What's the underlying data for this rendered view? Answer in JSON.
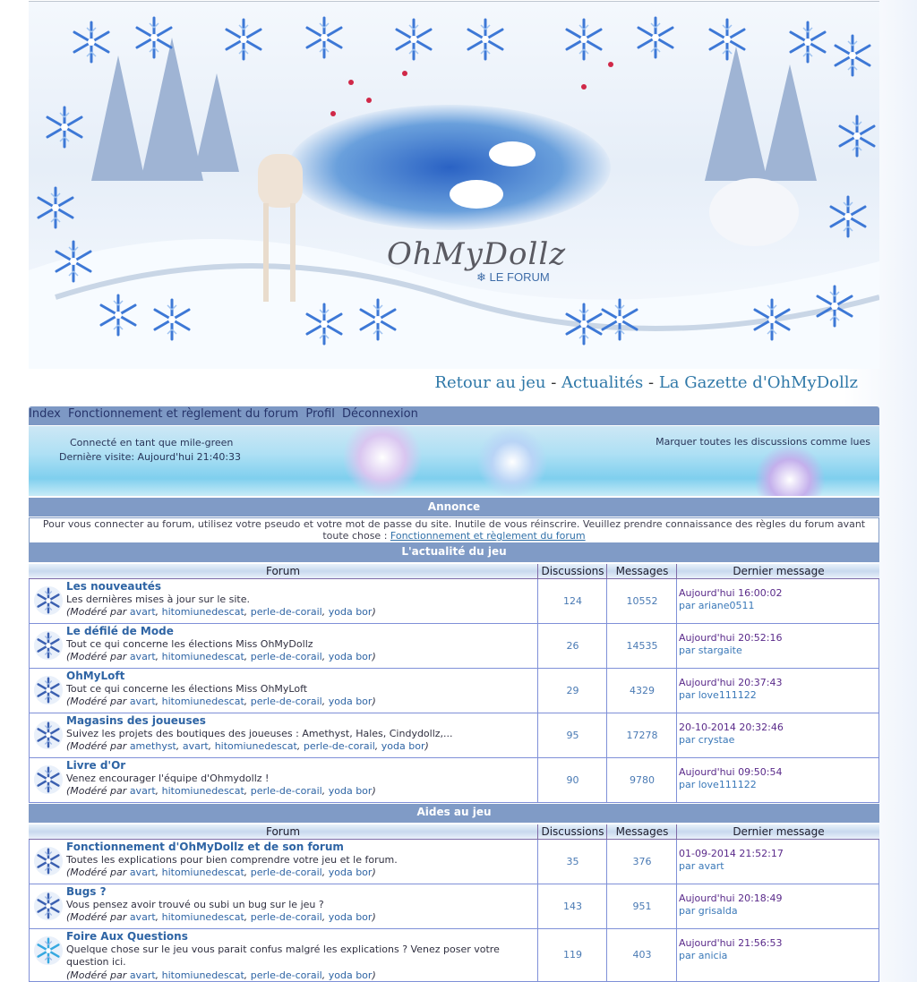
{
  "header": {
    "logo_text": "OhMyDollz",
    "logo_subtext": "LE FORUM",
    "links": [
      "Retour au jeu",
      "Actualités",
      "La Gazette d'OhMyDollz"
    ],
    "separator": " - "
  },
  "nav": {
    "items": [
      "Index",
      "Fonctionnement et règlement du forum",
      "Profil",
      "Déconnexion"
    ]
  },
  "info": {
    "connected": "Connecté en tant que mile-green",
    "last_visit": "Dernière visite: Aujourd'hui 21:40:33",
    "mark_read": "Marquer toutes les discussions comme lues"
  },
  "announcement": {
    "title": "Annonce",
    "text": "Pour vous connecter au forum, utilisez votre pseudo et votre mot de passe du site. Inutile de vous réinscrire. Veuillez prendre connaissance des règles du forum avant toute chose :",
    "link": "Fonctionnement et règlement du forum"
  },
  "columns": {
    "forum": "Forum",
    "discussions": "Discussions",
    "messages": "Messages",
    "last": "Dernier message"
  },
  "moderated_by": "Modéré par",
  "by_prefix": "par",
  "categories": [
    {
      "title": "L'actualité du jeu",
      "forums": [
        {
          "title": "Les nouveautés",
          "desc": "Les dernières mises à jour sur le site.",
          "mods": [
            "avart",
            "hitomiunedescat",
            "perle-de-corail",
            "yoda bor"
          ],
          "discussions": "124",
          "messages": "10552",
          "last_date": "Aujourd'hui 16:00:02",
          "last_user": "ariane0511"
        },
        {
          "title": "Le défilé de Mode",
          "desc": "Tout ce qui concerne les élections Miss OhMyDollz",
          "mods": [
            "avart",
            "hitomiunedescat",
            "perle-de-corail",
            "yoda bor"
          ],
          "discussions": "26",
          "messages": "14535",
          "last_date": "Aujourd'hui 20:52:16",
          "last_user": "stargaite"
        },
        {
          "title": "OhMyLoft",
          "desc": "Tout ce qui concerne les élections Miss OhMyLoft",
          "mods": [
            "avart",
            "hitomiunedescat",
            "perle-de-corail",
            "yoda bor"
          ],
          "discussions": "29",
          "messages": "4329",
          "last_date": "Aujourd'hui 20:37:43",
          "last_user": "love111122"
        },
        {
          "title": "Magasins des joueuses",
          "desc": "Suivez les projets des boutiques des joueuses : Amethyst, Hales, Cindydollz,...",
          "mods": [
            "amethyst",
            "avart",
            "hitomiunedescat",
            "perle-de-corail",
            "yoda bor"
          ],
          "discussions": "95",
          "messages": "17278",
          "last_date": "20-10-2014 20:32:46",
          "last_user": "crystae"
        },
        {
          "title": "Livre d'Or",
          "desc": "Venez encourager l'équipe d'Ohmydollz !",
          "mods": [
            "avart",
            "hitomiunedescat",
            "perle-de-corail",
            "yoda bor"
          ],
          "discussions": "90",
          "messages": "9780",
          "last_date": "Aujourd'hui 09:50:54",
          "last_user": "love111122"
        }
      ]
    },
    {
      "title": "Aides au jeu",
      "forums": [
        {
          "title": "Fonctionnement d'OhMyDollz et de son forum",
          "desc": "Toutes les explications pour bien comprendre votre jeu et le forum.",
          "mods": [
            "avart",
            "hitomiunedescat",
            "perle-de-corail",
            "yoda bor"
          ],
          "discussions": "35",
          "messages": "376",
          "last_date": "01-09-2014 21:52:17",
          "last_user": "avart"
        },
        {
          "title": "Bugs ?",
          "desc": "Vous pensez avoir trouvé ou subi un bug sur le jeu ?",
          "mods": [
            "avart",
            "hitomiunedescat",
            "perle-de-corail",
            "yoda bor"
          ],
          "discussions": "143",
          "messages": "951",
          "last_date": "Aujourd'hui 20:18:49",
          "last_user": "grisalda"
        },
        {
          "title": "Foire Aux Questions",
          "desc": "Quelque chose sur le jeu vous parait confus malgré les explications ? Venez poser votre question ici.",
          "mods": [
            "avart",
            "hitomiunedescat",
            "perle-de-corail",
            "yoda bor"
          ],
          "discussions": "119",
          "messages": "403",
          "last_date": "Aujourd'hui 21:56:53",
          "last_user": "anicia"
        }
      ]
    }
  ],
  "colors": {
    "header_blue": "#809bc6",
    "link_blue": "#2e64a4",
    "date_purple": "#5a2a8a"
  },
  "icons": {
    "forum_icon": "snowflake-icon",
    "forum_icon_new": "snowflake-new-icon"
  }
}
